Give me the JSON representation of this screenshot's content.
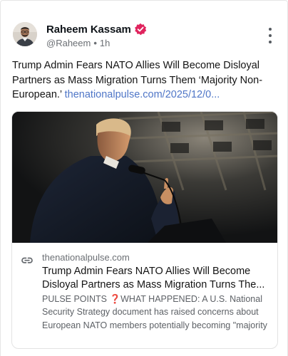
{
  "author": {
    "name": "Raheem Kassam",
    "handle": "@Raheem",
    "separator": "•",
    "time": "1h",
    "verified_icon": "verified-badge-icon",
    "badge_color": "#e0245e"
  },
  "menu": {
    "icon": "more-vertical-icon"
  },
  "post": {
    "text": "Trump Admin Fears NATO Allies Will Become Disloyal Partners as Mass Migration Turns Them ‘Majority Non-European.’ ",
    "link_text": "thenationalpulse.com/2025/12/0...",
    "link_color": "#4f76c7"
  },
  "link_card": {
    "image_subject": "photo-speaker-at-microphone",
    "link_icon": "link-icon",
    "domain": "thenationalpulse.com",
    "title": "Trump Admin Fears NATO Allies Will Become Disloyal Partners as Mass Migration Turns The...",
    "desc_prefix": "PULSE POINTS ",
    "desc_mark": "❓",
    "desc_rest": "WHAT HAPPENED: A U.S. National Security Strategy document has raised concerns about European NATO members potentially becoming \"majority"
  }
}
